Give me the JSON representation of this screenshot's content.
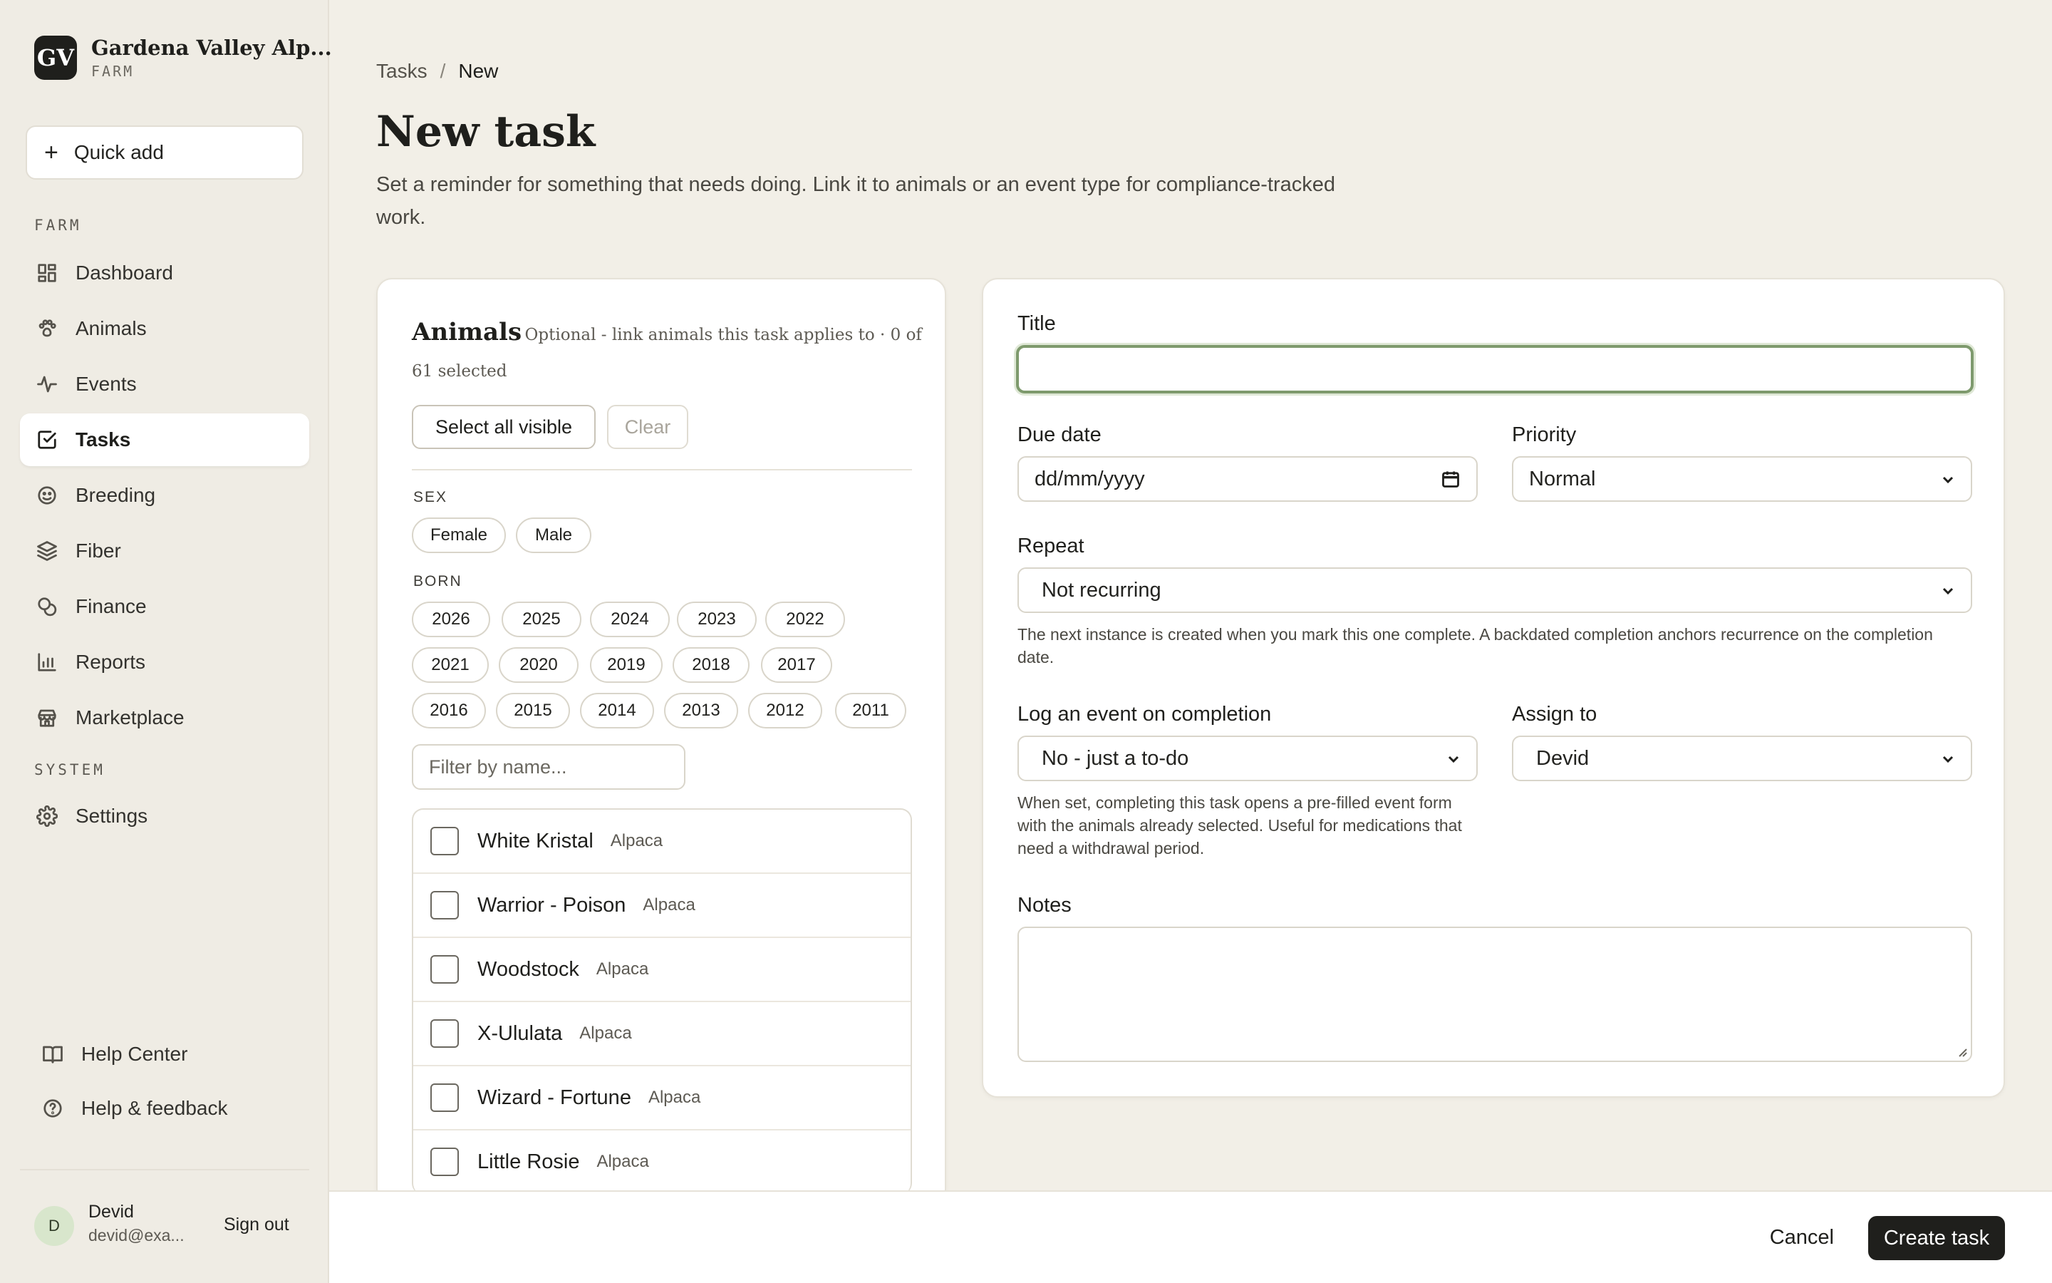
{
  "brand": {
    "logo_text": "GV",
    "name": "Gardena Valley Alp...",
    "subtitle": "FARM"
  },
  "sidebar": {
    "quick_add": "Quick add",
    "section_farm": "FARM",
    "section_system": "SYSTEM",
    "items": [
      {
        "label": "Dashboard",
        "icon": "dashboard-icon"
      },
      {
        "label": "Animals",
        "icon": "paw-icon"
      },
      {
        "label": "Events",
        "icon": "activity-icon"
      },
      {
        "label": "Tasks",
        "icon": "check-square-icon",
        "active": true
      },
      {
        "label": "Breeding",
        "icon": "face-icon"
      },
      {
        "label": "Fiber",
        "icon": "layers-icon"
      },
      {
        "label": "Finance",
        "icon": "coins-icon"
      },
      {
        "label": "Reports",
        "icon": "bar-chart-icon"
      },
      {
        "label": "Marketplace",
        "icon": "store-icon"
      }
    ],
    "settings": "Settings",
    "help_center": "Help Center",
    "help_feedback": "Help & feedback",
    "user": {
      "initial": "D",
      "name": "Devid",
      "email": "devid@exa...",
      "sign_out": "Sign out"
    }
  },
  "breadcrumb": {
    "parent": "Tasks",
    "separator": "/",
    "current": "New"
  },
  "page": {
    "title": "New task",
    "description": "Set a reminder for something that needs doing. Link it to animals or an event type for compliance-tracked work."
  },
  "animals": {
    "title": "Animals",
    "subtitle": "Optional - link animals this task applies to · 0 of 61 selected",
    "select_all": "Select all visible",
    "clear": "Clear",
    "sex_label": "SEX",
    "sex_options": [
      "Female",
      "Male"
    ],
    "born_label": "BORN",
    "born_options": [
      "2026",
      "2025",
      "2024",
      "2023",
      "2022",
      "2021",
      "2020",
      "2019",
      "2018",
      "2017",
      "2016",
      "2015",
      "2014",
      "2013",
      "2012",
      "2011"
    ],
    "filter_placeholder": "Filter by name...",
    "list": [
      {
        "name": "White Kristal",
        "type": "Alpaca"
      },
      {
        "name": "Warrior - Poison",
        "type": "Alpaca"
      },
      {
        "name": "Woodstock",
        "type": "Alpaca"
      },
      {
        "name": "X-Ululata",
        "type": "Alpaca"
      },
      {
        "name": "Wizard - Fortune",
        "type": "Alpaca"
      },
      {
        "name": "Little Rosie",
        "type": "Alpaca"
      }
    ]
  },
  "form": {
    "title_label": "Title",
    "title_value": "",
    "due_label": "Due date",
    "due_placeholder": "dd/mm/yyyy",
    "priority_label": "Priority",
    "priority_value": "Normal",
    "repeat_label": "Repeat",
    "repeat_value": "Not recurring",
    "repeat_help": "The next instance is created when you mark this one complete. A backdated completion anchors recurrence on the completion date.",
    "log_label": "Log an event on completion",
    "log_value": "No - just a to-do",
    "log_help": "When set, completing this task opens a pre-filled event form with the animals already selected. Useful for medications that need a withdrawal period.",
    "assign_label": "Assign to",
    "assign_value": "Devid",
    "notes_label": "Notes",
    "notes_value": ""
  },
  "footer": {
    "cancel": "Cancel",
    "create": "Create task"
  },
  "colors": {
    "background": "#f2efe7",
    "primary": "#1f1f1c",
    "focus": "#7e9a6d"
  }
}
